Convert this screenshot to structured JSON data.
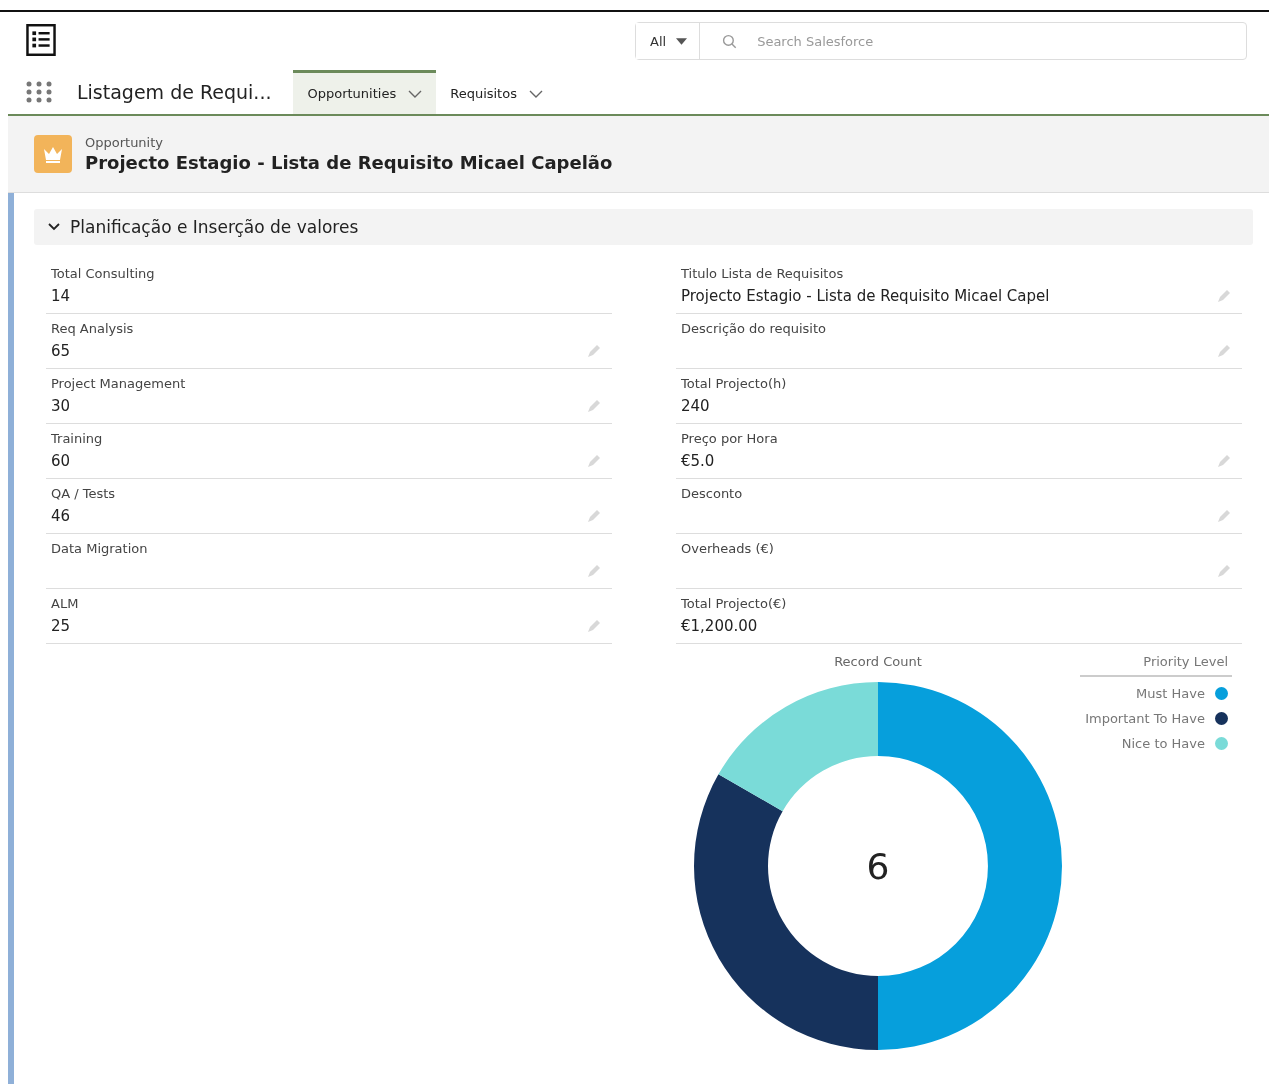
{
  "search": {
    "scope": "All",
    "placeholder": "Search Salesforce"
  },
  "app_name": "Listagem de Requi...",
  "tabs": [
    {
      "label": "Opportunities",
      "selected": true
    },
    {
      "label": "Requisitos",
      "selected": false
    }
  ],
  "record": {
    "type": "Opportunity",
    "title": "Projecto Estagio - Lista de Requisito Micael Capelão"
  },
  "section": {
    "title": "Planificação e Inserção de valores",
    "expanded": true
  },
  "left_fields": [
    {
      "label": "Total Consulting",
      "value": "14",
      "editable": false
    },
    {
      "label": "Req Analysis",
      "value": "65",
      "editable": true
    },
    {
      "label": "Project Management",
      "value": "30",
      "editable": true
    },
    {
      "label": "Training",
      "value": "60",
      "editable": true
    },
    {
      "label": "QA / Tests",
      "value": "46",
      "editable": true
    },
    {
      "label": "Data Migration",
      "editable": true
    },
    {
      "label": "ALM",
      "value": "25",
      "editable": true
    }
  ],
  "right_fields": [
    {
      "label": "Titulo Lista de Requisitos",
      "value": "Projecto Estagio - Lista de Requisito Micael Capel",
      "editable": true
    },
    {
      "label": "Descrição do requisito",
      "editable": true
    },
    {
      "label": "Total Projecto(h)",
      "value": "240",
      "editable": false
    },
    {
      "label": "Preço por Hora",
      "value": "€5.0",
      "editable": true
    },
    {
      "label": "Desconto",
      "editable": true
    },
    {
      "label": "Overheads (€)",
      "editable": true
    },
    {
      "label": "Total Projecto(€)",
      "value": "€1,200.00",
      "editable": false
    }
  ],
  "chart": {
    "total": "6",
    "legend_title": "Priority Level",
    "chart_data": {
      "type": "donut",
      "title": "Record Count",
      "categories": [
        "Must Have",
        "Important To Have",
        "Nice to Have"
      ],
      "series": [
        {
          "values": [
            50,
            33.3,
            16.7
          ]
        }
      ],
      "legend": "right",
      "colors": [
        "#069fdc",
        "#16325c",
        "#7adbd8"
      ]
    }
  }
}
